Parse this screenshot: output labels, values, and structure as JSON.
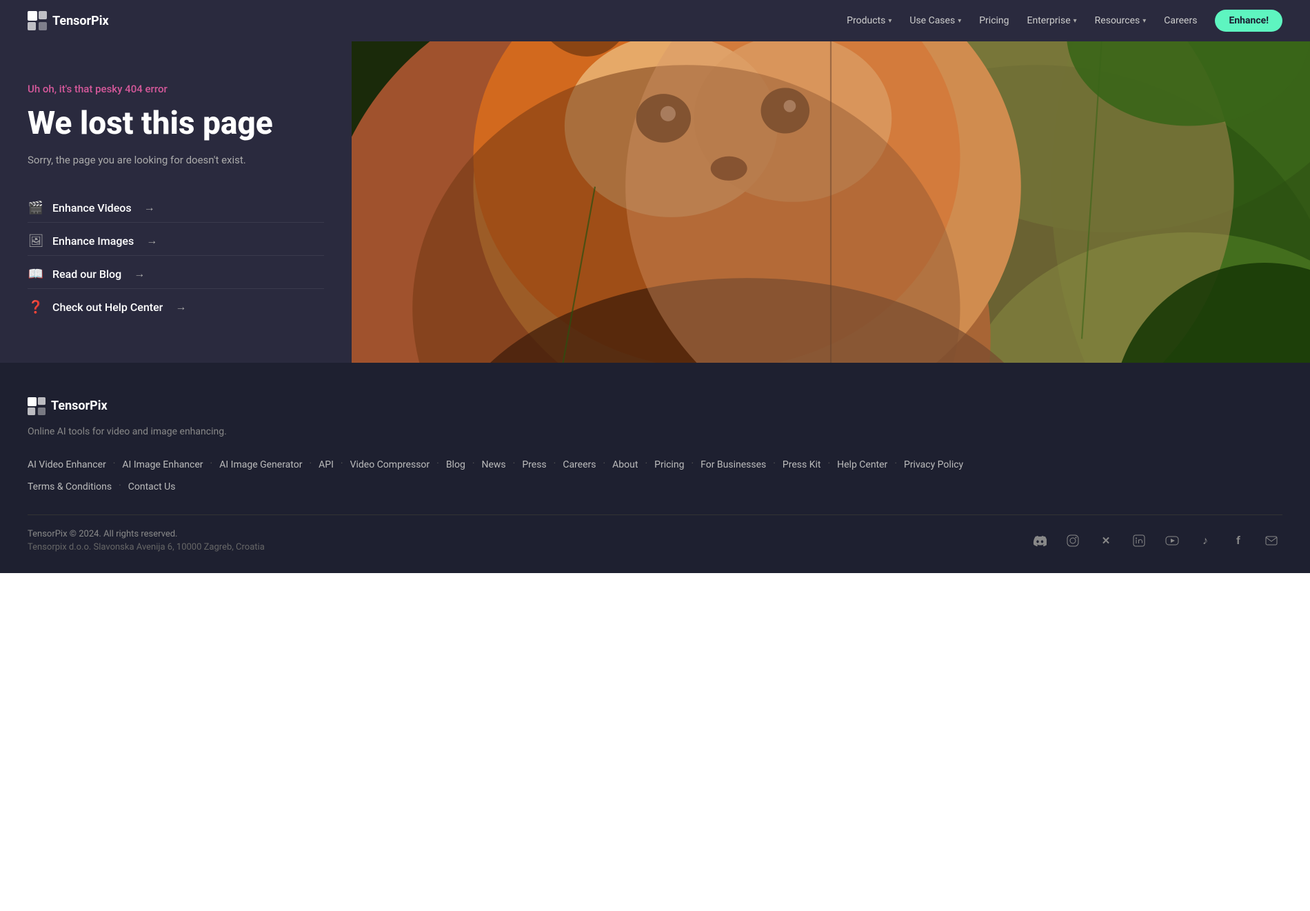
{
  "header": {
    "logo_text": "TensorPix",
    "nav": [
      {
        "label": "Products",
        "has_dropdown": true
      },
      {
        "label": "Use Cases",
        "has_dropdown": true
      },
      {
        "label": "Pricing",
        "has_dropdown": false
      },
      {
        "label": "Enterprise",
        "has_dropdown": true
      },
      {
        "label": "Resources",
        "has_dropdown": true
      },
      {
        "label": "Careers",
        "has_dropdown": false
      }
    ],
    "cta_label": "Enhance!"
  },
  "hero": {
    "error_label": "Uh oh, it's that pesky 404 error",
    "title": "We lost this page",
    "subtitle": "Sorry, the page you are looking for doesn't exist.",
    "links": [
      {
        "icon": "video",
        "label": "Enhance Videos",
        "arrow": "→"
      },
      {
        "icon": "image",
        "label": "Enhance Images",
        "arrow": "→"
      },
      {
        "icon": "blog",
        "label": "Read our Blog",
        "arrow": "→"
      },
      {
        "icon": "help",
        "label": "Check out Help Center",
        "arrow": "→"
      }
    ]
  },
  "footer": {
    "logo_text": "TensorPix",
    "tagline": "Online AI tools for video and image enhancing.",
    "links_row1": [
      "AI Video Enhancer",
      "AI Image Enhancer",
      "AI Image Generator",
      "API",
      "Video Compressor",
      "Blog",
      "News",
      "Press",
      "Careers",
      "About",
      "Pricing",
      "For Businesses",
      "Press Kit",
      "Help Center",
      "Privacy Policy"
    ],
    "links_row2": [
      "Terms & Conditions",
      "Contact Us"
    ],
    "copyright": "TensorPix © 2024. All rights reserved.",
    "address": "Tensorpix d.o.o.  Slavonska Avenija 6, 10000 Zagreb, Croatia",
    "social_icons": [
      {
        "name": "discord",
        "symbol": "💬"
      },
      {
        "name": "instagram",
        "symbol": "📷"
      },
      {
        "name": "twitter-x",
        "symbol": "✕"
      },
      {
        "name": "linkedin",
        "symbol": "in"
      },
      {
        "name": "youtube",
        "symbol": "▶"
      },
      {
        "name": "tiktok",
        "symbol": "♪"
      },
      {
        "name": "facebook",
        "symbol": "f"
      },
      {
        "name": "email",
        "symbol": "✉"
      }
    ]
  }
}
